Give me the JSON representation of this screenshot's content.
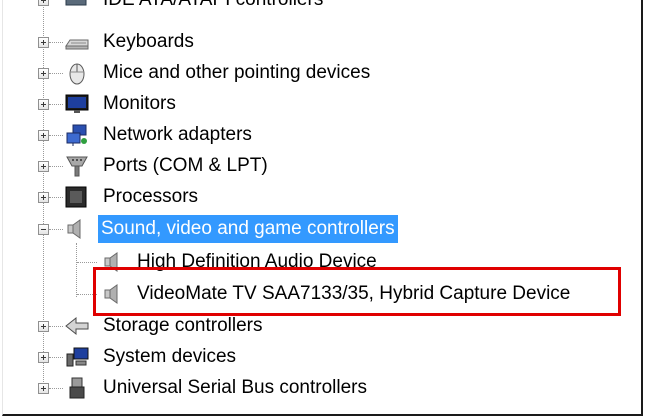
{
  "tree": {
    "partial_top_label": "IDE ATA/ATAPI controllers",
    "items": [
      {
        "label": "Keyboards",
        "icon": "keyboard-icon"
      },
      {
        "label": "Mice and other pointing devices",
        "icon": "mouse-icon"
      },
      {
        "label": "Monitors",
        "icon": "monitor-icon"
      },
      {
        "label": "Network adapters",
        "icon": "network-adapter-icon"
      },
      {
        "label": "Ports (COM & LPT)",
        "icon": "port-icon"
      },
      {
        "label": "Processors",
        "icon": "processor-icon"
      },
      {
        "label": "Sound, video and game controllers",
        "icon": "speaker-icon",
        "expanded": true,
        "selected": true
      },
      {
        "label": "High Definition Audio Device",
        "icon": "speaker-icon",
        "child": true
      },
      {
        "label": "VideoMate TV SAA7133/35, Hybrid Capture Device",
        "icon": "speaker-icon",
        "child": true
      },
      {
        "label": "Storage controllers",
        "icon": "storage-controller-icon"
      },
      {
        "label": "System devices",
        "icon": "system-devices-icon"
      },
      {
        "label": "Universal Serial Bus controllers",
        "icon": "usb-icon"
      }
    ]
  },
  "colors": {
    "selection_bg": "#3399ff",
    "selection_text": "#ffffff",
    "highlight_border": "#e00000"
  }
}
